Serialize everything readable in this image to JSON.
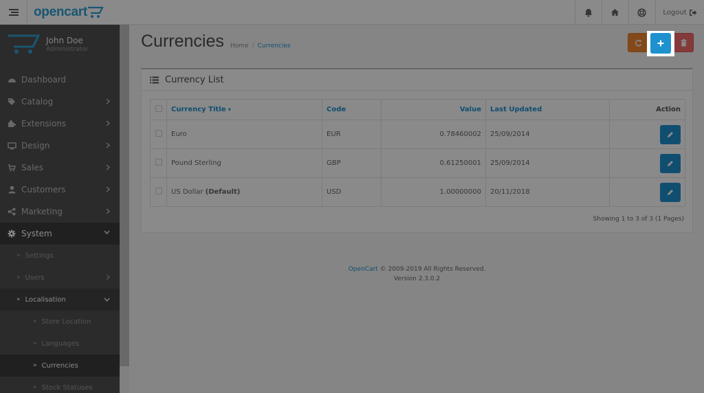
{
  "header": {
    "logo": "opencart",
    "logout_label": "Logout",
    "icons": [
      "menu-icon",
      "bell-icon",
      "home-icon",
      "help-icon",
      "logout-icon"
    ]
  },
  "profile": {
    "name": "John Doe",
    "role": "Administrator"
  },
  "sidebar": {
    "items": [
      {
        "label": "Dashboard",
        "icon": "dashboard-icon"
      },
      {
        "label": "Catalog",
        "icon": "tag-icon"
      },
      {
        "label": "Extensions",
        "icon": "puzzle-icon"
      },
      {
        "label": "Design",
        "icon": "monitor-icon"
      },
      {
        "label": "Sales",
        "icon": "cart-icon"
      },
      {
        "label": "Customers",
        "icon": "user-icon"
      },
      {
        "label": "Marketing",
        "icon": "share-icon"
      },
      {
        "label": "System",
        "icon": "gear-icon"
      }
    ],
    "system_sub": [
      "Settings",
      "Users",
      "Localisation"
    ],
    "localisation_sub": [
      "Store Location",
      "Languages",
      "Currencies",
      "Stock Statuses"
    ]
  },
  "page": {
    "title": "Currencies",
    "breadcrumb": [
      "Home",
      "Currencies"
    ]
  },
  "panel": {
    "title": "Currency List",
    "columns": [
      "Currency Title",
      "Code",
      "Value",
      "Last Updated",
      "Action"
    ],
    "rows": [
      {
        "title": "Euro",
        "default": "",
        "code": "EUR",
        "value": "0.78460002",
        "updated": "25/09/2014"
      },
      {
        "title": "Pound Sterling",
        "default": "",
        "code": "GBP",
        "value": "0.61250001",
        "updated": "25/09/2014"
      },
      {
        "title": "US Dollar",
        "default": "(Default)",
        "code": "USD",
        "value": "1.00000000",
        "updated": "20/11/2018"
      }
    ],
    "showing": "Showing 1 to 3 of 3 (1 Pages)"
  },
  "footer": {
    "link": "OpenCart",
    "copyright": "© 2009-2019 All Rights Reserved.",
    "version": "Version 2.3.0.2"
  },
  "colors": {
    "accent": "#1e91cf",
    "refresh": "#f38733",
    "delete": "#f56b6b",
    "sidebar": "#515151"
  }
}
